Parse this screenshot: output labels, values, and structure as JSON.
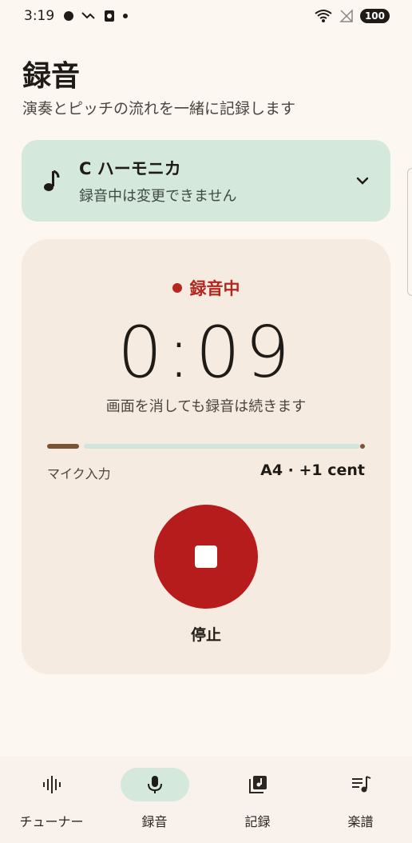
{
  "status_bar": {
    "time": "3:19",
    "battery": "100"
  },
  "header": {
    "title": "録音",
    "subtitle": "演奏とピッチの流れを一緒に記録します"
  },
  "instrument": {
    "icon": "music-note-icon",
    "name": "C ハーモニカ",
    "note": "録音中は変更できません"
  },
  "recording": {
    "status": "録音中",
    "timer": "0:09",
    "hint": "画面を消しても録音は続きます",
    "mic_label": "マイク入力",
    "pitch": "A4 · +1 cent",
    "input_level_fraction": 0.1,
    "stop_label": "停止"
  },
  "nav": {
    "items": [
      {
        "label": "チューナー",
        "icon": "waveform-icon",
        "active": false
      },
      {
        "label": "録音",
        "icon": "microphone-icon",
        "active": true
      },
      {
        "label": "記録",
        "icon": "music-library-icon",
        "active": false
      },
      {
        "label": "楽譜",
        "icon": "playlist-music-icon",
        "active": false
      }
    ]
  },
  "colors": {
    "background": "#fdf7f1",
    "accent_green": "#d4e8dc",
    "record_red": "#b71c1c",
    "level_brown": "#7b5434"
  }
}
